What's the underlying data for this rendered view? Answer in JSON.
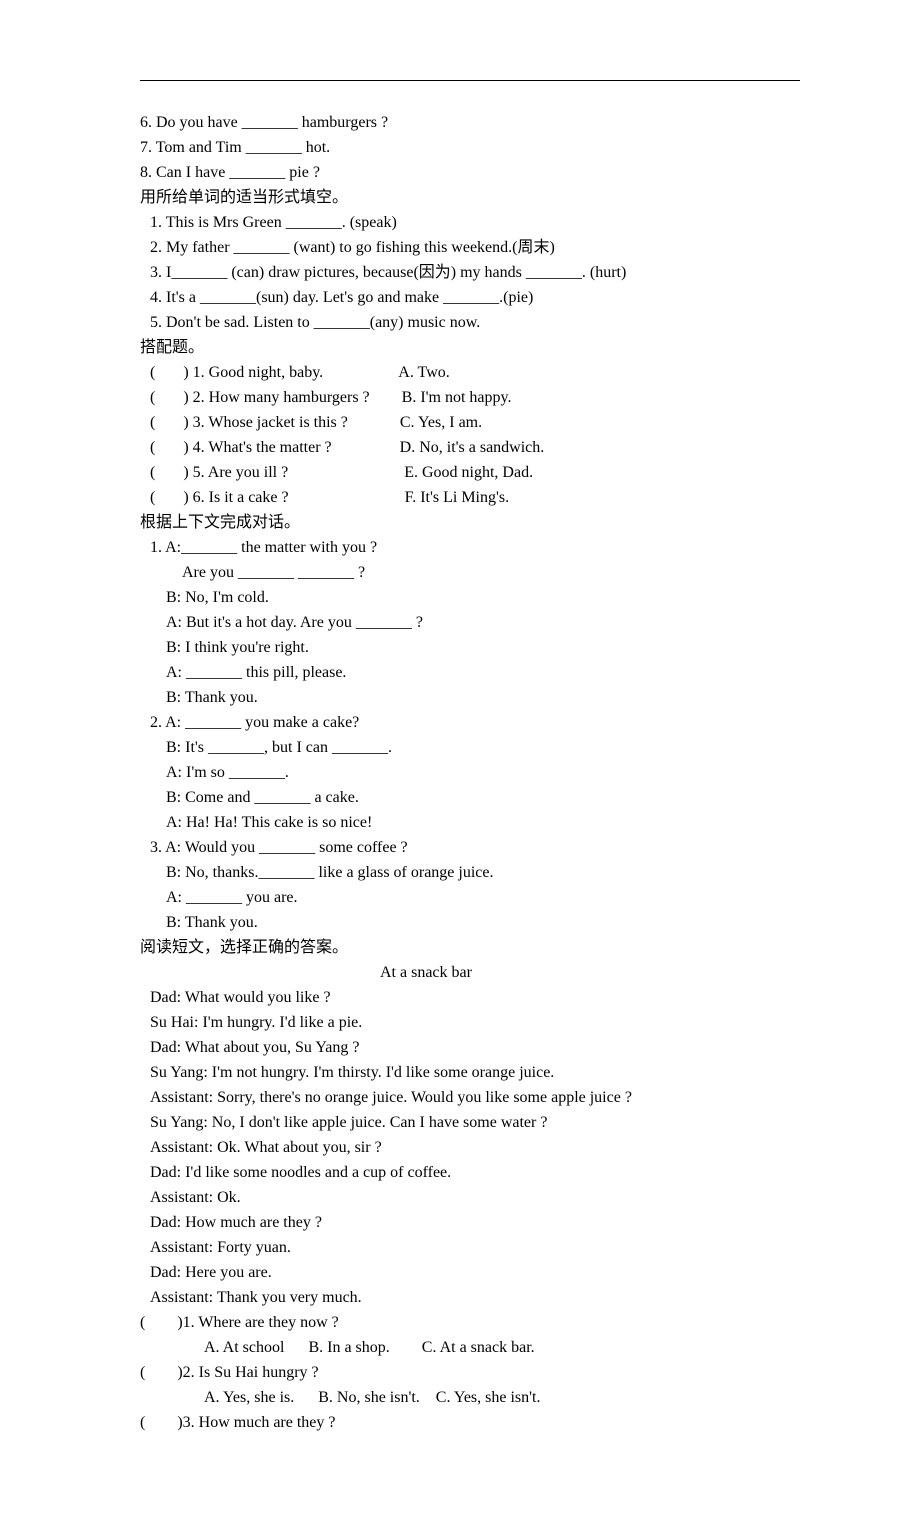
{
  "fill_continued": [
    "6. Do you have _______ hamburgers ?",
    "7. Tom and Tim _______ hot.",
    "8. Can I have _______ pie ?"
  ],
  "section_fillform_title": "用所给单词的适当形式填空。",
  "fillform": [
    "1. This is Mrs Green _______. (speak)",
    "2. My father _______ (want) to go fishing this weekend.(周末)",
    "3. I_______ (can) draw pictures, because(因为) my hands _______. (hurt)",
    "4. It's a _______(sun) day. Let's go and make _______.(pie)",
    "5. Don't be sad. Listen to _______(any) music now."
  ],
  "section_match_title": "搭配题。",
  "match": [
    "(       ) 1. Good night, baby.                   A. Two.",
    "(       ) 2. How many hamburgers ?        B. I'm not happy.",
    "(       ) 3. Whose jacket is this ?             C. Yes, I am.",
    "(       ) 4. What's the matter ?                 D. No, it's a sandwich.",
    "(       ) 5. Are you ill ?                             E. Good night, Dad.",
    "(       ) 6. Is it a cake ?                             F. It's Li Ming's."
  ],
  "section_dialogue_title": "根据上下文完成对话。",
  "dialogue1": [
    "1. A:_______ the matter with you ?",
    "        Are you _______ _______ ?",
    "    B: No, I'm cold.",
    "    A: But it's a hot day. Are you _______ ?",
    "    B: I think you're right.",
    "    A: _______ this pill, please.",
    "    B: Thank you."
  ],
  "dialogue2": [
    "2. A: _______ you make a cake?",
    "    B: It's _______, but I can _______.",
    "    A: I'm so _______.",
    "    B: Come and _______ a cake.",
    "    A: Ha! Ha! This cake is so nice!"
  ],
  "dialogue3": [
    "3. A: Would you _______ some coffee ?",
    "    B: No, thanks._______ like a glass of orange juice.",
    "    A: _______ you are.",
    "    B: Thank you."
  ],
  "section_reading_title": "阅读短文，选择正确的答案。",
  "reading_heading": "At a snack bar",
  "reading_body": [
    "Dad: What would you like ?",
    "Su Hai: I'm hungry. I'd like a pie.",
    "Dad: What about you, Su Yang ?",
    "Su Yang: I'm not hungry. I'm thirsty. I'd like some orange juice.",
    "Assistant: Sorry, there's no orange juice. Would you like some apple juice ?",
    "Su Yang: No, I don't like apple juice. Can I have some water ?",
    "Assistant: Ok. What about you, sir ?",
    "Dad: I'd like some noodles and a cup of coffee.",
    "Assistant: Ok.",
    "Dad: How much are they ?",
    "Assistant: Forty yuan.",
    "Dad: Here you are.",
    "Assistant: Thank you very much."
  ],
  "reading_questions": [
    {
      "q": "(        )1. Where are they now ?",
      "opts": "A. At school      B. In a shop.        C. At a snack bar."
    },
    {
      "q": "(        )2. Is Su Hai hungry ?",
      "opts": "A. Yes, she is.      B. No, she isn't.    C. Yes, she isn't."
    },
    {
      "q": "(        )3. How much are they ?",
      "opts": ""
    }
  ]
}
